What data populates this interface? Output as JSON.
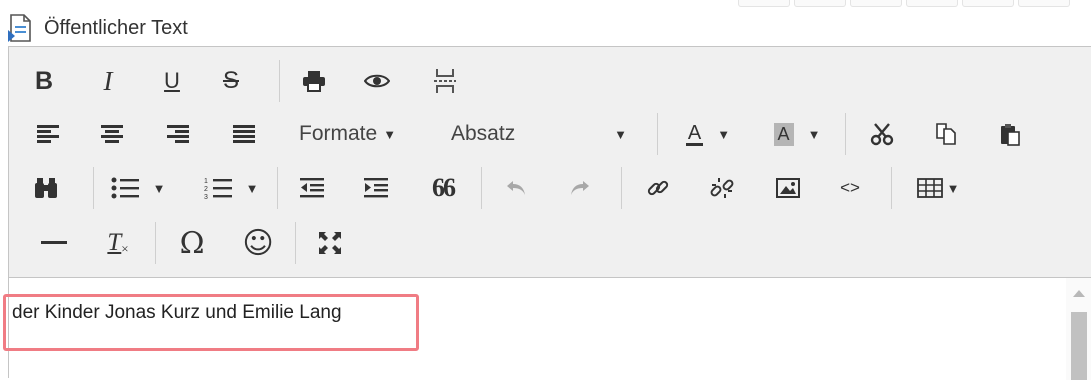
{
  "header": {
    "title": "Öffentlicher Text"
  },
  "toolbar": {
    "formats_label": "Formate",
    "block_label": "Absatz",
    "quote_glyph": "66",
    "omega_glyph": "Ω",
    "smile_glyph": "☺",
    "bold_glyph": "B",
    "italic_glyph": "I",
    "underline_glyph": "U",
    "strike_glyph": "S",
    "font_color_glyph": "A",
    "bg_color_glyph": "A",
    "code_glyph": "<>",
    "clear_format_glyph": "T"
  },
  "editor": {
    "content_text": "der Kinder Jonas Kurz und Emilie Lang"
  },
  "colors": {
    "highlight_border": "#f07c84",
    "toolbar_bg": "#f0f0f0"
  }
}
